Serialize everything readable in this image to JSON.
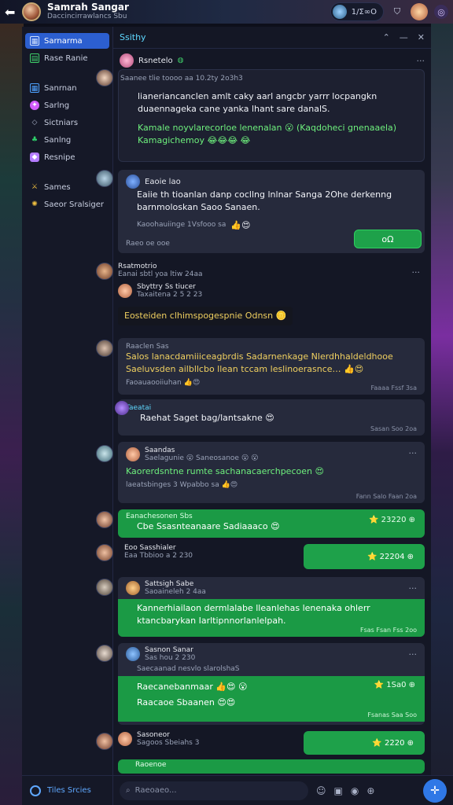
{
  "topbar": {
    "title": "Samrah Sangar",
    "subtitle": "Daccincirrawlancs Sbu",
    "pill_text": "1/Σ∞Ο",
    "icons": [
      "back-arrow-icon",
      "bookmark-icon",
      "profile-icon",
      "settings-icon"
    ]
  },
  "sidebar": {
    "items": [
      {
        "label": "Sarnarma",
        "icon": "chart-icon",
        "color": "#4ea2ff",
        "active": true
      },
      {
        "label": "Rase Ranie",
        "icon": "grid-icon",
        "color": "#3fd06a",
        "active": false
      },
      {
        "label": "Sanrnan",
        "icon": "chart-icon",
        "color": "#4ea2ff"
      },
      {
        "label": "Sarlng",
        "icon": "star-icon",
        "color": "#d25cff"
      },
      {
        "label": "Sictniars",
        "icon": "diamond-icon",
        "color": "#aab2c8"
      },
      {
        "label": "Sanlng",
        "icon": "leaf-icon",
        "color": "#2ed06a"
      },
      {
        "label": "Resnipe",
        "icon": "badge-icon",
        "color": "#b47cff"
      },
      {
        "label": "Sames",
        "icon": "sword-icon",
        "color": "#f0c040"
      },
      {
        "label": "Saeor Sralsiger",
        "icon": "sun-icon",
        "color": "#f0c040"
      }
    ],
    "footer_label": "Tiles Srcies"
  },
  "chat": {
    "title": "Ssithy",
    "header_user": "Rsnetelo",
    "messages": [
      {
        "id": "m1",
        "meta": "Saanee tlie toooo aa 10.2ty 2o3h3",
        "text": "lianeriancanclen amlt caky aarl angcbr yarrr locpangkn duaennageka cane yanka lhant sare danalS.",
        "green_text": "Kamale noyvlarecorloe lenenalan 😮 (Kaqdoheci gnenaaela)",
        "green_text2": "Kamagichemoy 😂😂😂 😂",
        "emojis": ""
      },
      {
        "id": "m2",
        "sender": "Eaoie lao",
        "text": "Eaiie th tioanlan danp cocllng lnlnar Sanga 2Ohe derkenng barnmoloskan Saoo Sanaen.",
        "meta_line": "Kaoohauiinge 1Vsfooo sa",
        "action_label": "oΩ"
      },
      {
        "id": "m3",
        "sender": "Rsatmotrio",
        "meta": "Eanai sbtl yoa ltiw 24aa ",
        "sub_sender": "Sbyttry Ss tiucer",
        "sub_meta": "Taxaitena 2 5 2 23",
        "yellow_text": "Eosteiden clhimspogespnie Odnsn 🪙"
      },
      {
        "id": "m4",
        "sender": "Raaclen Sas",
        "text": "Salos lanacdamiiiceagbrdis Sadarnenkage Nlerdhhaldeldhooe Saeluvsden ailbllcbo llean tccam leslinoerasnce… 👍😍",
        "meta_line": "Faoauaooiiuhan 👍😍",
        "ts": "Faaaa Fssf 3sa"
      },
      {
        "id": "m5",
        "sender": "Taeatai",
        "text": "Raehat Saget bag/lantsakne 😍",
        "ts": "Sasan Soo 2oa"
      },
      {
        "id": "m6",
        "sender": "Saandas",
        "meta": "Saelagunie 😮 Saneosanoe 😮 😮",
        "green_text": "Kaorerdsntne rumte sachanacaerchpecoen 😍",
        "meta_line": "laeatsbinges 3 Wpabbo sa 👍😍",
        "ts": "Fann Salo Faan 2oa"
      },
      {
        "id": "m7",
        "sender": "Eanachesonen Sbs",
        "text": "Cbe Ssasnteanaare Sadiaaaco 😍",
        "action_label": "⭐ 23220 ⊕"
      },
      {
        "id": "m8",
        "sender": "Eoo Sasshialer",
        "meta": "Eaa Tbbioo a 2 230",
        "action_label": "⭐ 22204 ⊕"
      },
      {
        "id": "m9",
        "sender": "Sattsigh Sabe",
        "meta": "Saoaineleh 2 4aa",
        "text": "Kannerhiailaon dermlalabe lleanlehas lenenaka ohlerr ktancbarykan Iarltipnnorlanlelpah.",
        "ts": "Fsas Fsan Fss 2oo"
      },
      {
        "id": "m10",
        "sender": "Sasnon Sanar",
        "meta": "Sas hou 2 230",
        "sub_meta": "Saecaanad nesvlo slarolshaS",
        "line1": "Raecanebanmaar 👍😍 😮",
        "line2": "Raacaoe Sbaanen 😍😍",
        "action_label": "⭐ 1Sa0 ⊕",
        "ts": "Fsanas Saa Soo"
      },
      {
        "id": "m11",
        "sender": "Sasoneor",
        "meta": "Sagoos Sbeiahs 3",
        "action_label": "⭐ 2220 ⊕"
      },
      {
        "id": "m12",
        "sender": "Raoenoe"
      }
    ]
  },
  "composer": {
    "placeholder": "Raeoaeo...",
    "icons": [
      "emoji-icon",
      "image-icon",
      "sticker-icon",
      "attach-icon",
      "send-icon"
    ]
  }
}
